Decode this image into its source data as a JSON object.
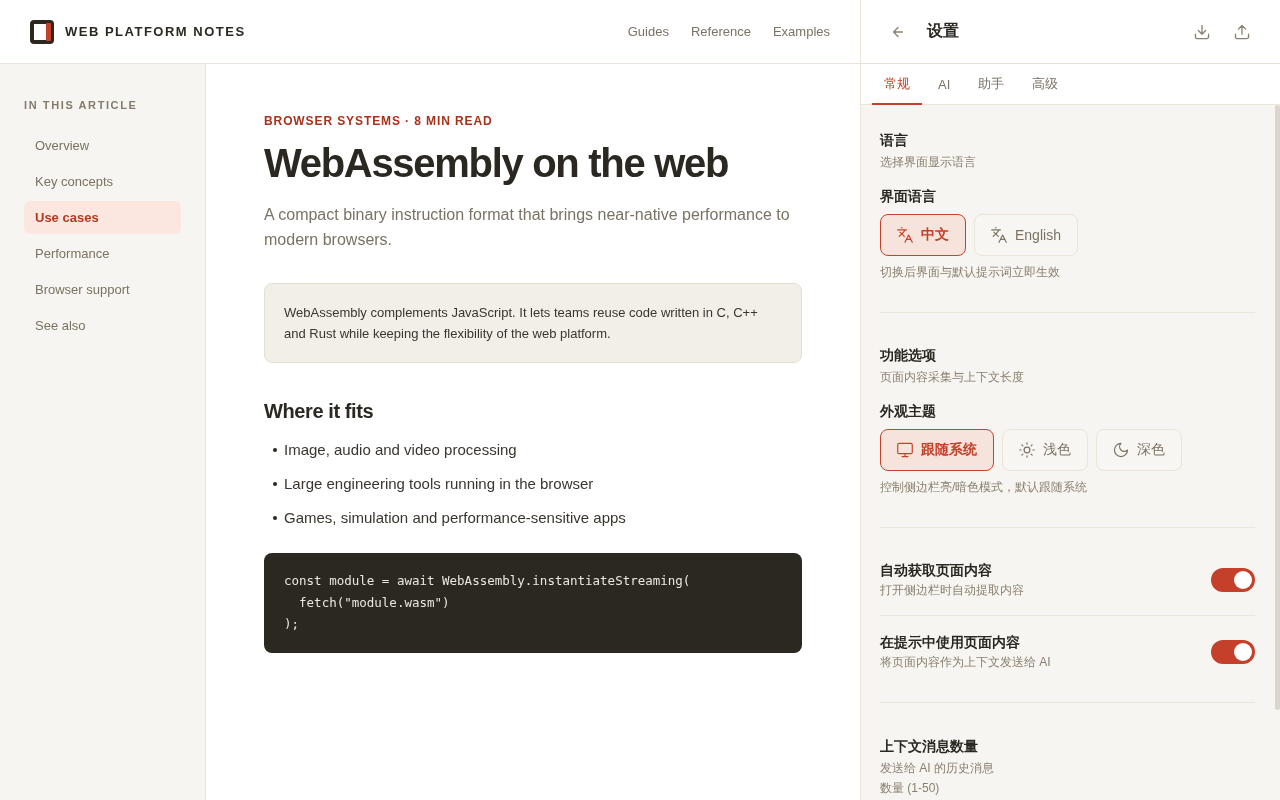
{
  "site_header": {
    "logo_text": "WEB PLATFORM NOTES",
    "nav": [
      "Guides",
      "Reference",
      "Examples"
    ]
  },
  "sidebar": {
    "heading": "IN THIS ARTICLE",
    "items": [
      {
        "label": "Overview",
        "selected": false
      },
      {
        "label": "Key concepts",
        "selected": false
      },
      {
        "label": "Use cases",
        "selected": true
      },
      {
        "label": "Performance",
        "selected": false
      },
      {
        "label": "Browser support",
        "selected": false
      },
      {
        "label": "See also",
        "selected": false
      }
    ]
  },
  "article": {
    "kicker": "BROWSER SYSTEMS · 8 MIN READ",
    "title": "WebAssembly on the web",
    "subtitle": "A compact binary instruction format that brings near-native performance to modern browsers.",
    "callout": "WebAssembly complements JavaScript. It lets teams reuse code written in C, C++ and Rust while keeping the flexibility of the web platform.",
    "section_heading": "Where it fits",
    "bullets": [
      "Image, audio and video processing",
      "Large engineering tools running in the browser",
      "Games, simulation and performance-sensitive apps"
    ],
    "code": [
      "const module = await WebAssembly.instantiateStreaming(",
      "  fetch(\"module.wasm\")",
      ");"
    ]
  },
  "settings": {
    "title": "设置",
    "tabs": [
      {
        "label": "常规",
        "selected": true
      },
      {
        "label": "AI",
        "selected": false
      },
      {
        "label": "助手",
        "selected": false
      },
      {
        "label": "高级",
        "selected": false
      }
    ],
    "sections": [
      {
        "title": "语言",
        "description": "选择界面显示语言",
        "group_label": "界面语言",
        "options": [
          {
            "label": "中文",
            "kind": "language",
            "selected": true
          },
          {
            "label": "English",
            "kind": "language",
            "selected": false
          }
        ],
        "hint": "切换后界面与默认提示词立即生效"
      },
      {
        "title": "功能选项",
        "description": "页面内容采集与上下文长度",
        "group_label": "外观主题",
        "options": [
          {
            "label": "跟随系统",
            "kind": "system",
            "selected": true
          },
          {
            "label": "浅色",
            "kind": "light",
            "selected": false
          },
          {
            "label": "深色",
            "kind": "dark",
            "selected": false
          }
        ],
        "hint": "控制侧边栏亮/暗色模式，默认跟随系统"
      }
    ],
    "toggles": [
      {
        "title": "自动获取页面内容",
        "description": "打开侧边栏时自动提取内容",
        "on": true
      },
      {
        "title": "在提示中使用页面内容",
        "description": "将页面内容作为上下文发送给 AI",
        "on": true
      }
    ],
    "message_count": {
      "title": "上下文消息数量",
      "description": "发送给 AI 的历史消息数量 (1-50)"
    }
  }
}
